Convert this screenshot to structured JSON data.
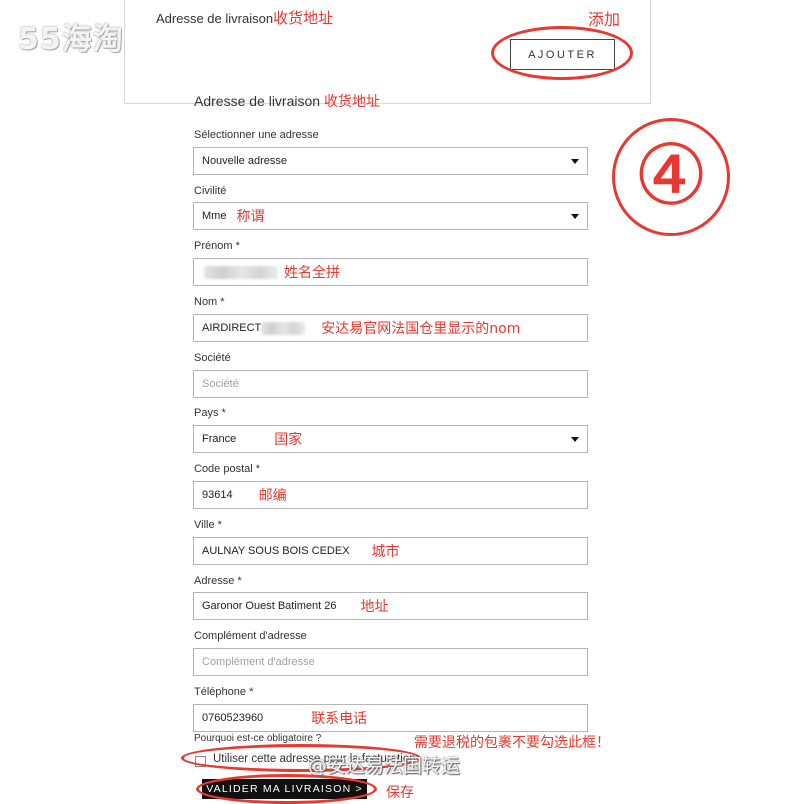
{
  "watermark": "55海淘",
  "top": {
    "label": "Adresse de livraison",
    "label_note": "收货地址",
    "add_note": "添加",
    "ajouter_label": "AJOUTER"
  },
  "badge": "④",
  "form": {
    "title": "Adresse de livraison",
    "title_note": "收货地址",
    "select_address": {
      "label": "Sélectionner une adresse",
      "value": "Nouvelle adresse"
    },
    "civilite": {
      "label": "Civilité",
      "value": "Mme",
      "note": "称谓"
    },
    "prenom": {
      "label": "Prénom",
      "required": "*",
      "value": "",
      "note": "姓名全拼"
    },
    "nom": {
      "label": "Nom",
      "required": "*",
      "value": "AIRDIRECT",
      "note": "安达易官网法国仓里显示的nom"
    },
    "societe": {
      "label": "Société",
      "placeholder": "Société"
    },
    "pays": {
      "label": "Pays",
      "required": "*",
      "value": "France",
      "note": "国家"
    },
    "code_postal": {
      "label": "Code postal",
      "required": "*",
      "value": "93614",
      "note": "邮编"
    },
    "ville": {
      "label": "Ville",
      "required": "*",
      "value": "AULNAY SOUS BOIS CEDEX",
      "note": "城市"
    },
    "adresse": {
      "label": "Adresse",
      "required": "*",
      "value": "Garonor Ouest Batiment 26",
      "note": "地址"
    },
    "complement": {
      "label": "Complément d'adresse",
      "placeholder": "Complément d'adresse"
    },
    "telephone": {
      "label": "Téléphone",
      "required": "*",
      "value": "0760523960",
      "note": "联系电话"
    },
    "why_required": "Pourquoi est-ce obligatoire ?",
    "checkbox_label": "Utiliser cette adresse pour la facturation",
    "checkbox_checked": false,
    "checkbox_note": "需要退税的包裹不要勾选此框！",
    "submit_label": "VALIDER MA LIVRAISON >",
    "submit_note": "保存"
  },
  "credit_watermark": "@安达易法国转运",
  "colors": {
    "annotation_red": "#e8382f",
    "button_black": "#111111"
  }
}
